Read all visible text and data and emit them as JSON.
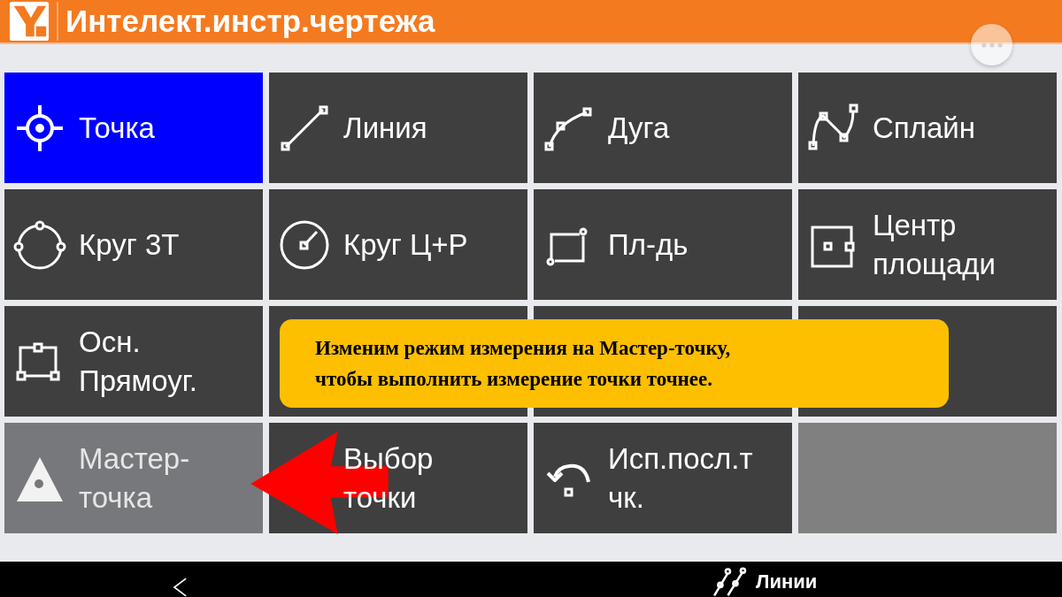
{
  "header": {
    "title": "Интелект.инстр.чертежа"
  },
  "tools": [
    {
      "kind": "point",
      "lines": [
        "Точка"
      ],
      "selected": true,
      "disabled": false
    },
    {
      "kind": "line",
      "lines": [
        "Линия"
      ],
      "selected": false,
      "disabled": false
    },
    {
      "kind": "arc",
      "lines": [
        "Дуга"
      ],
      "selected": false,
      "disabled": false
    },
    {
      "kind": "spline",
      "lines": [
        "Сплайн"
      ],
      "selected": false,
      "disabled": false
    },
    {
      "kind": "circle3",
      "lines": [
        "Круг 3Т"
      ],
      "selected": false,
      "disabled": false
    },
    {
      "kind": "circlecr",
      "lines": [
        "Круг Ц+Р"
      ],
      "selected": false,
      "disabled": false
    },
    {
      "kind": "area",
      "lines": [
        "Пл-дь"
      ],
      "selected": false,
      "disabled": false
    },
    {
      "kind": "areacenter",
      "lines": [
        "Центр",
        "площади"
      ],
      "selected": false,
      "disabled": false
    },
    {
      "kind": "rect",
      "lines": [
        "Осн.",
        "Прямоуг."
      ],
      "selected": false,
      "disabled": false
    },
    {
      "kind": "blank",
      "selected": false,
      "disabled": false
    },
    {
      "kind": "blank",
      "selected": false,
      "disabled": false
    },
    {
      "kind": "blank",
      "selected": false,
      "disabled": false
    },
    {
      "kind": "master",
      "lines": [
        "Мастер-",
        "точка"
      ],
      "selected": false,
      "disabled": true
    },
    {
      "kind": "pick",
      "lines": [
        "Выбор",
        "точки"
      ],
      "selected": false,
      "disabled": false
    },
    {
      "kind": "last",
      "lines": [
        "Исп.посл.т",
        "чк."
      ],
      "selected": false,
      "disabled": false
    },
    {
      "kind": "blank",
      "selected": false,
      "disabled": true
    }
  ],
  "tooltip": {
    "lines": [
      "Изменим режим измерения на Мастер-точку,",
      "чтобы выполнить измерение точки точнее."
    ]
  },
  "bottom_bar": {
    "tab": "Линии"
  }
}
